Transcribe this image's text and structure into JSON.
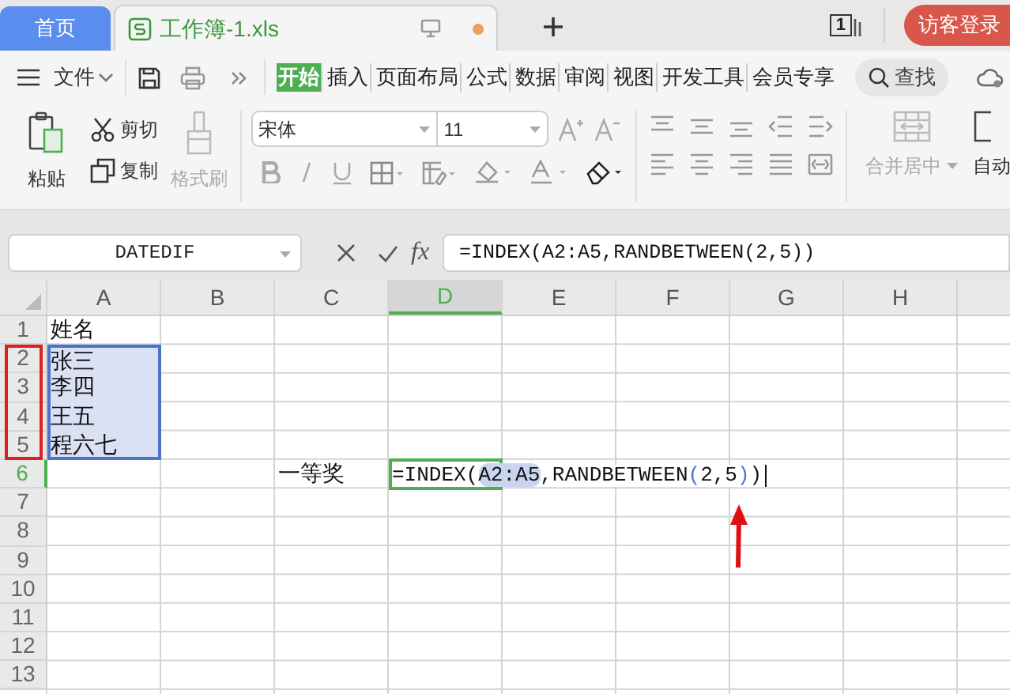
{
  "tabs": [
    {
      "label": "首页",
      "kind": "home",
      "selected": false
    },
    {
      "label": "工作簿-1.xls",
      "kind": "workbook",
      "selected": true,
      "unsaved": true
    }
  ],
  "window_count": "1",
  "login": "访客登录",
  "menu": {
    "file": "文件",
    "search": "查找",
    "tabs": [
      {
        "label": "开始",
        "selected": true
      },
      {
        "label": "插入",
        "selected": false
      },
      {
        "label": "页面布局",
        "selected": false
      },
      {
        "label": "公式",
        "selected": false
      },
      {
        "label": "数据",
        "selected": false
      },
      {
        "label": "审阅",
        "selected": false
      },
      {
        "label": "视图",
        "selected": false
      },
      {
        "label": "开发工具",
        "selected": false
      },
      {
        "label": "会员专享",
        "selected": false
      }
    ]
  },
  "ribbon": {
    "paste": "粘贴",
    "cut": "剪切",
    "copy": "复制",
    "format_painter": {
      "label": "格式刷",
      "disabled": true
    },
    "font_name": "宋体",
    "font_size": "11",
    "merge": {
      "label": "合并居中",
      "disabled": true
    },
    "wrap": "自动"
  },
  "formula_bar": {
    "name_box": "DATEDIF",
    "function_label": "fx",
    "formula": "=INDEX(A2:A5,RANDBETWEEN(2,5))"
  },
  "sheet": {
    "columns": [
      {
        "label": "A",
        "selected": false
      },
      {
        "label": "B",
        "selected": false
      },
      {
        "label": "C",
        "selected": false
      },
      {
        "label": "D",
        "selected": true
      },
      {
        "label": "E",
        "selected": false
      },
      {
        "label": "F",
        "selected": false
      },
      {
        "label": "G",
        "selected": false
      },
      {
        "label": "H",
        "selected": false
      }
    ],
    "rows": [
      {
        "number": "1",
        "active": false,
        "cells": [
          {
            "text": "姓名",
            "in_range": false
          }
        ]
      },
      {
        "number": "2",
        "active": false,
        "cells": [
          {
            "text": "张三",
            "in_range": true
          }
        ]
      },
      {
        "number": "3",
        "active": false,
        "cells": [
          {
            "text": "李四",
            "in_range": true
          }
        ]
      },
      {
        "number": "4",
        "active": false,
        "cells": [
          {
            "text": "王五",
            "in_range": true
          }
        ]
      },
      {
        "number": "5",
        "active": false,
        "cells": [
          {
            "text": "程六七",
            "in_range": true
          }
        ]
      },
      {
        "number": "6",
        "active": true,
        "cells": [
          {},
          {},
          {
            "text": "一等奖"
          },
          {
            "active": true,
            "parts": [
              {
                "text": "=INDEX(",
                "kind": "plain"
              },
              {
                "text": "A2:A5",
                "kind": "reference"
              },
              {
                "text": ",RANDBETWEEN",
                "kind": "plain"
              },
              {
                "text": "(",
                "kind": "paren"
              },
              {
                "text": "2,5",
                "kind": "plain"
              },
              {
                "text": ")",
                "kind": "paren"
              },
              {
                "text": ")",
                "kind": "plain"
              }
            ]
          }
        ]
      },
      {
        "number": "7",
        "active": false,
        "cells": []
      },
      {
        "number": "8",
        "active": false,
        "cells": []
      },
      {
        "number": "9",
        "active": false,
        "cells": []
      },
      {
        "number": "10",
        "active": false,
        "cells": []
      },
      {
        "number": "11",
        "active": false,
        "cells": []
      },
      {
        "number": "12",
        "active": false,
        "cells": []
      },
      {
        "number": "13",
        "active": false,
        "cells": []
      }
    ]
  }
}
